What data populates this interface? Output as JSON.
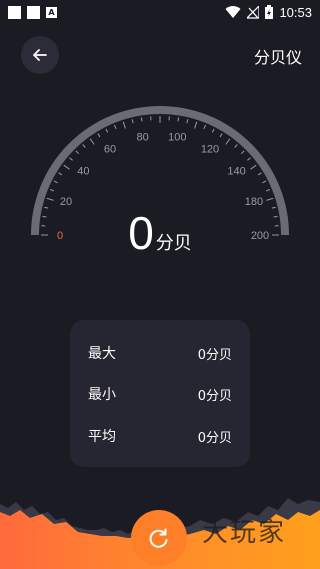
{
  "status_bar": {
    "time": "10:53"
  },
  "header": {
    "title": "分贝仪"
  },
  "gauge": {
    "ticks": [
      "0",
      "20",
      "40",
      "60",
      "80",
      "100",
      "120",
      "140",
      "180",
      "200"
    ],
    "min": 0,
    "max": 200,
    "level": 0,
    "colors": {
      "track": "#6b6b74",
      "zero_tick": "#f06a3e",
      "tick": "#9a9aa4"
    }
  },
  "reading": {
    "value": "0",
    "unit": "分贝"
  },
  "stats": {
    "max": {
      "label": "最大",
      "value": "0分贝"
    },
    "min": {
      "label": "最小",
      "value": "0分贝"
    },
    "avg": {
      "label": "平均",
      "value": "0分贝"
    }
  },
  "watermark": "大玩家",
  "colors": {
    "background": "#1b1b24",
    "card": "#262632",
    "accent": "#ff7f28"
  }
}
